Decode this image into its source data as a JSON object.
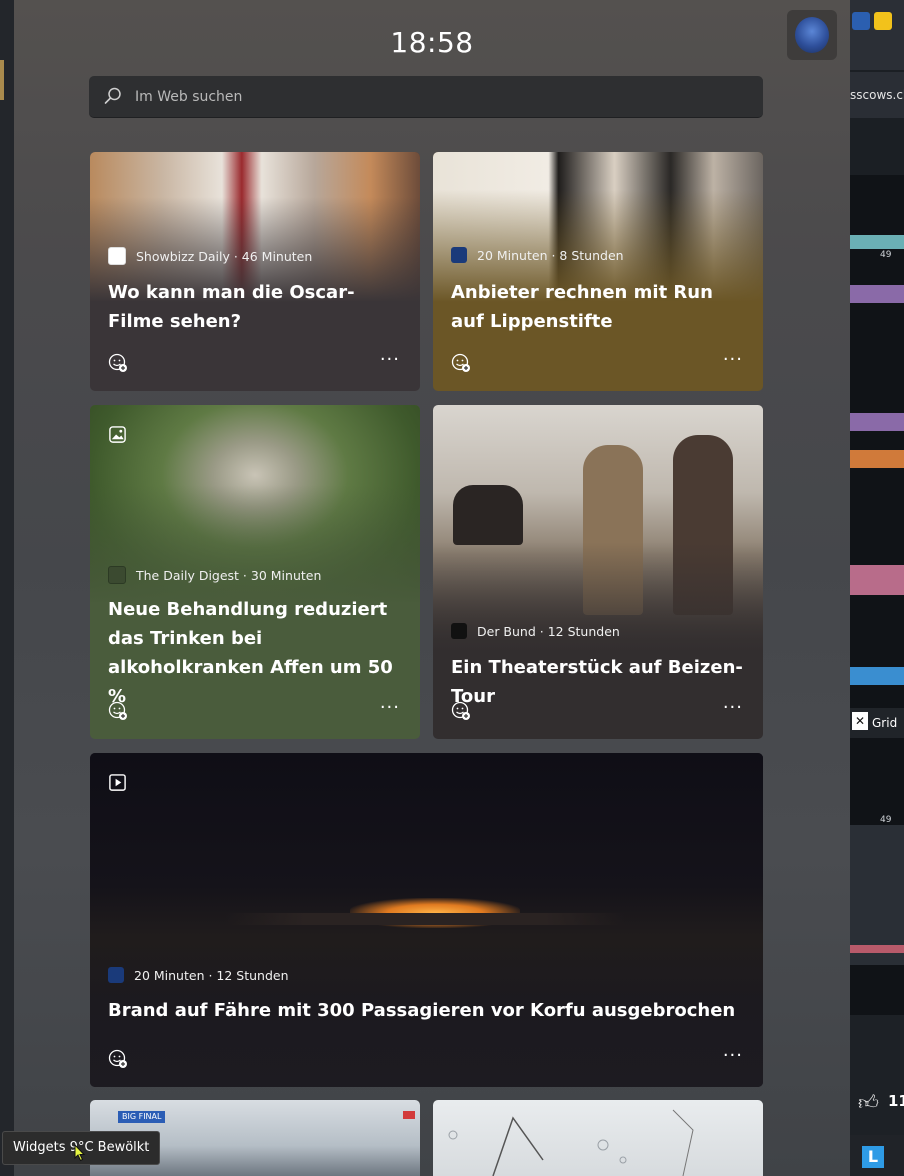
{
  "widget": {
    "time": "18:58",
    "search": {
      "placeholder": "Im Web suchen"
    }
  },
  "cards": [
    {
      "source": "Showbizz Daily · 46 Minuten",
      "title": "Wo kann man die Oscar-Filme sehen?"
    },
    {
      "source": "20 Minuten · 8 Stunden",
      "title": "Anbieter rechnen mit Run auf Lippenstifte"
    },
    {
      "source": "The Daily Digest · 30 Minuten",
      "title": "Neue Behandlung reduziert das Trinken bei alkoholkranken Affen um 50 %"
    },
    {
      "source": "Der Bund · 12 Stunden",
      "title": "Ein Theaterstück auf Beizen-Tour"
    },
    {
      "source": "20 Minuten · 12 Stunden",
      "title": "Brand auf Fähre mit 300 Passagieren vor Korfu ausgebrochen"
    }
  ],
  "more_label": "···",
  "partial_cards": [
    {
      "tag": "BIG FINAL"
    }
  ],
  "taskbar": {
    "tooltip": "Widgets 9°C Bewölkt"
  },
  "background_app": {
    "url_fragment": "sscows.ch",
    "marker_1": "49",
    "marker_2": "49",
    "grid_label": "Grid",
    "like_count": "11",
    "tile_letter": "L"
  },
  "icons": [
    "search-icon",
    "reaction-add-icon",
    "more-icon",
    "image-gallery-icon",
    "video-play-icon",
    "avatar"
  ],
  "colors": {
    "panel": "#4b4a4c",
    "card_dark": "#3a3538",
    "card_gold": "#6b5626",
    "card_green": "#4a5c3c",
    "card_charcoal": "#322e2f",
    "card_night": "#1d1b21"
  }
}
